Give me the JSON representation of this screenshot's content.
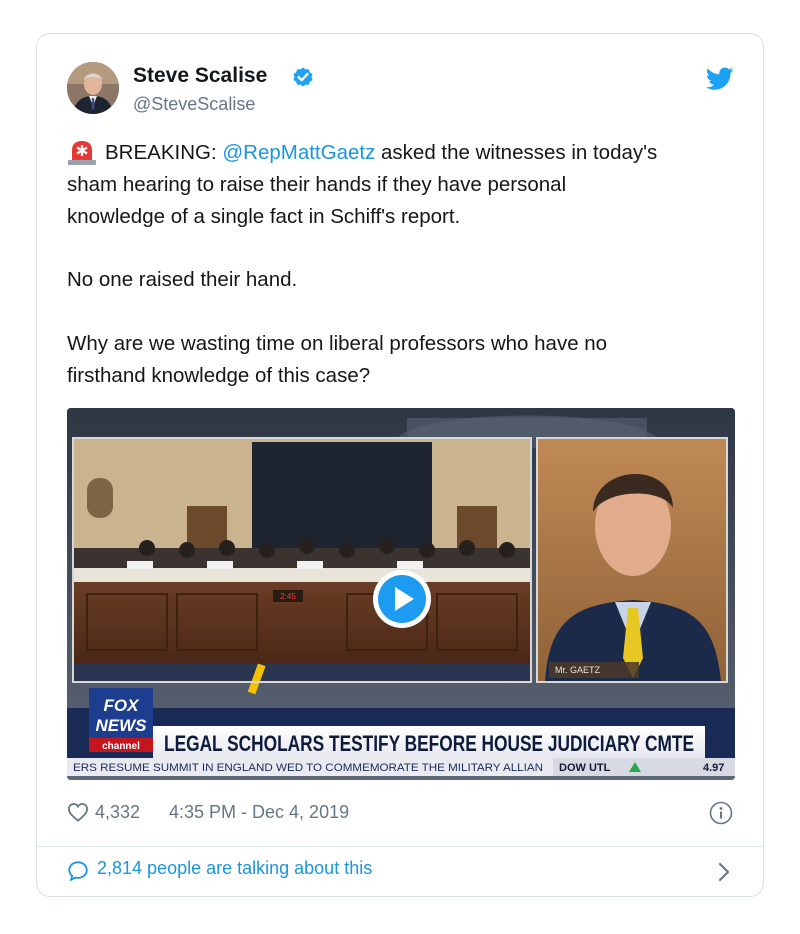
{
  "tweet": {
    "author_name": "Steve Scalise",
    "author_handle": "@SteveScalise",
    "line1_prefix": "BREAKING: ",
    "line1_mention": "@RepMattGaetz",
    "line1_suffix": " asked the witnesses in today's",
    "line2": "sham hearing to raise their hands if they have personal",
    "line3": "knowledge of a single fact in Schiff's report.",
    "para2": "No one raised their hand.",
    "para3_line1": "Why are we wasting time on liberal professors who have no",
    "para3_line2": "firsthand knowledge of this case?",
    "likes": "4,332",
    "timestamp": "4:35 PM - Dec 4, 2019",
    "talking": "2,814 people are talking about this"
  },
  "video": {
    "network_top": "FOX",
    "network_mid": "NEWS",
    "network_bottom": "channel",
    "headline": "LEGAL SCHOLARS TESTIFY BEFORE HOUSE JUDICIARY CMTE",
    "ticker": "ERS RESUME SUMMIT IN ENGLAND WED TO COMMEMORATE THE MILITARY ALLIAN",
    "market_label": "DOW UTL",
    "market_value": "4.97",
    "name_tag": "Mr. GAETZ",
    "clock": "2:45"
  },
  "icons": {
    "verified": "verified-badge-icon",
    "bird": "twitter-bird-icon",
    "siren": "rotating-light-emoji",
    "heart": "heart-icon",
    "info": "info-icon",
    "bubble": "speech-bubble-icon",
    "chevron": "chevron-right-icon",
    "play": "play-icon"
  },
  "colors": {
    "accent": "#1b95e0",
    "text": "#14171a",
    "muted": "#657786"
  }
}
